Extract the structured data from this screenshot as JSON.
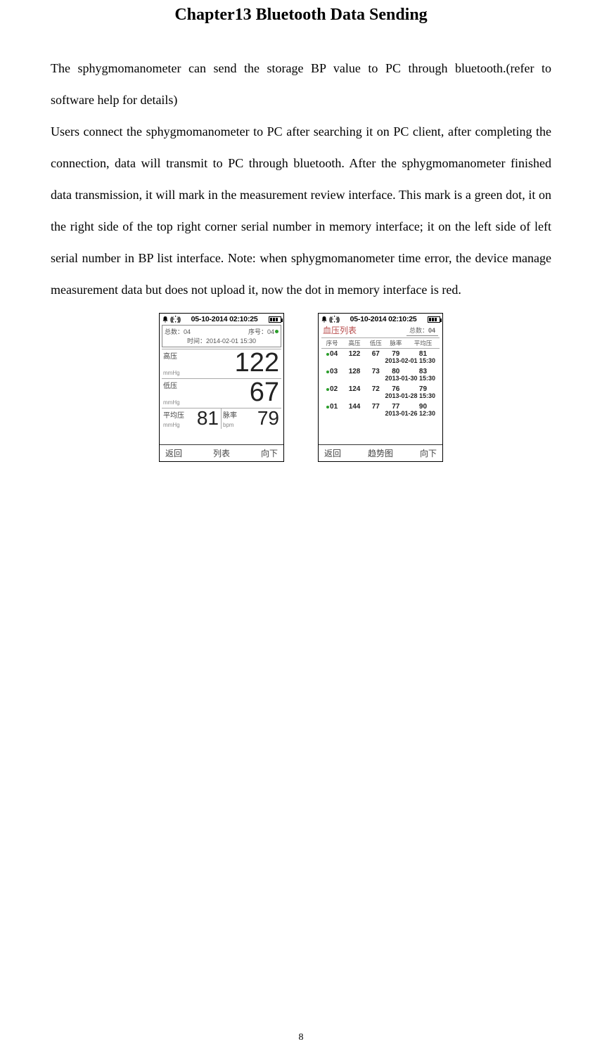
{
  "chapter_title": "Chapter13 Bluetooth Data Sending",
  "paragraph1a": "The sphygmomanometer can send the storage BP value to PC through bluetooth.(refer to",
  "paragraph1b": "software help for details)",
  "paragraph2": "Users connect the sphygmomanometer to PC after searching it on PC client, after completing the connection, data will transmit to PC through bluetooth. After the sphygmomanometer finished data transmission, it will mark in the measurement review interface. This mark is a green dot, it on the right side of the top right corner serial number in memory interface; it on the left side of left serial number in BP list interface. Note: when sphygmomanometer time error, the device manage measurement data but does not upload it, now the dot in memory interface is red.",
  "status": {
    "datetime": "05-10-2014 02:10:25"
  },
  "screenA": {
    "total_label": "总数：04",
    "seq_label": "序号：04",
    "time_label": "时间：2014-02-01  15:30",
    "high_label": "高压",
    "low_label": "低压",
    "avg_label": "平均压",
    "pulse_label": "脉率",
    "unit_mmhg": "mmHg",
    "unit_bpm": "bpm",
    "high_val": "122",
    "low_val": "67",
    "avg_val": "81",
    "pulse_val": "79",
    "btn_back": "返回",
    "btn_list": "列表",
    "btn_down": "向下"
  },
  "screenB": {
    "title": "血压列表",
    "total_label": "总数：",
    "total_val": "04",
    "hdr_seq": "序号",
    "hdr_high": "高压",
    "hdr_low": "低压",
    "hdr_pulse": "脉率",
    "hdr_avg": "平均压",
    "rows": [
      {
        "seq": "04",
        "high": "122",
        "low": "67",
        "pulse": "79",
        "avg": "81",
        "ts": "2013-02-01 15:30"
      },
      {
        "seq": "03",
        "high": "128",
        "low": "73",
        "pulse": "80",
        "avg": "83",
        "ts": "2013-01-30 15:30"
      },
      {
        "seq": "02",
        "high": "124",
        "low": "72",
        "pulse": "76",
        "avg": "79",
        "ts": "2013-01-28 15:30"
      },
      {
        "seq": "01",
        "high": "144",
        "low": "77",
        "pulse": "77",
        "avg": "90",
        "ts": "2013-01-26 12:30"
      }
    ],
    "btn_back": "返回",
    "btn_trend": "趋势图",
    "btn_down": "向下"
  },
  "page_number": "8"
}
